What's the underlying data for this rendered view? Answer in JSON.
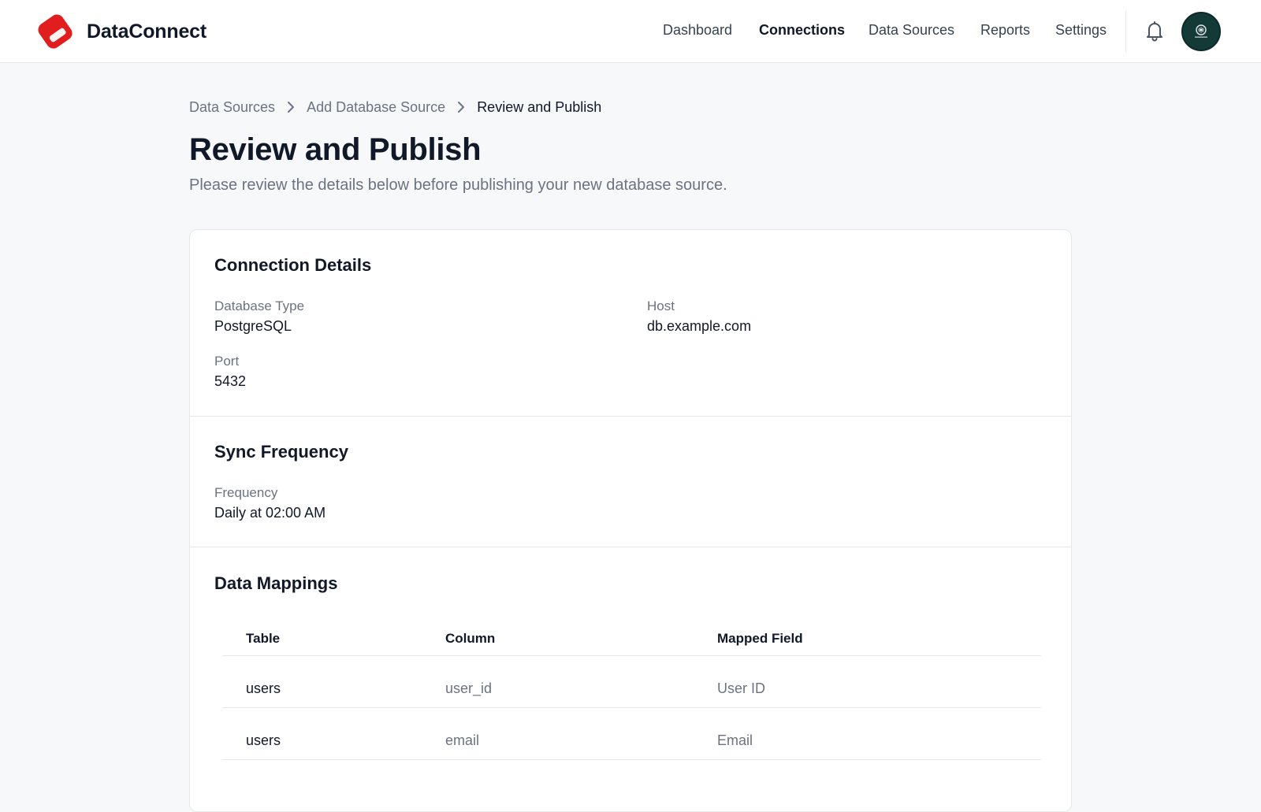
{
  "brand": {
    "name": "DataConnect",
    "accent": "#e11d1d"
  },
  "nav": {
    "items": [
      {
        "label": "Dashboard",
        "active": false
      },
      {
        "label": "Connections",
        "active": true
      },
      {
        "label": "Data Sources",
        "active": false
      },
      {
        "label": "Reports",
        "active": false
      },
      {
        "label": "Settings",
        "active": false
      }
    ],
    "icons": {
      "notifications": "bell-icon",
      "profile": "avatar"
    }
  },
  "breadcrumb": {
    "items": [
      "Data Sources",
      "Add Database Source",
      "Review and Publish"
    ],
    "separator_icon": "chevron-right-icon"
  },
  "page": {
    "title": "Review and Publish",
    "subtitle": "Please review the details below before publishing your new database source."
  },
  "connection": {
    "title": "Connection Details",
    "fields": [
      {
        "label": "Database Type",
        "value": "PostgreSQL"
      },
      {
        "label": "Host",
        "value": "db.example.com"
      },
      {
        "label": "Port",
        "value": "5432"
      }
    ]
  },
  "sync": {
    "title": "Sync Frequency",
    "fields": [
      {
        "label": "Frequency",
        "value": "Daily at 02:00 AM"
      }
    ]
  },
  "mappings": {
    "title": "Data Mappings",
    "columns": [
      "Table",
      "Column",
      "Mapped Field"
    ],
    "rows": [
      {
        "table": "users",
        "column": "user_id",
        "mapped": "User ID"
      },
      {
        "table": "users",
        "column": "email",
        "mapped": "Email"
      }
    ]
  }
}
